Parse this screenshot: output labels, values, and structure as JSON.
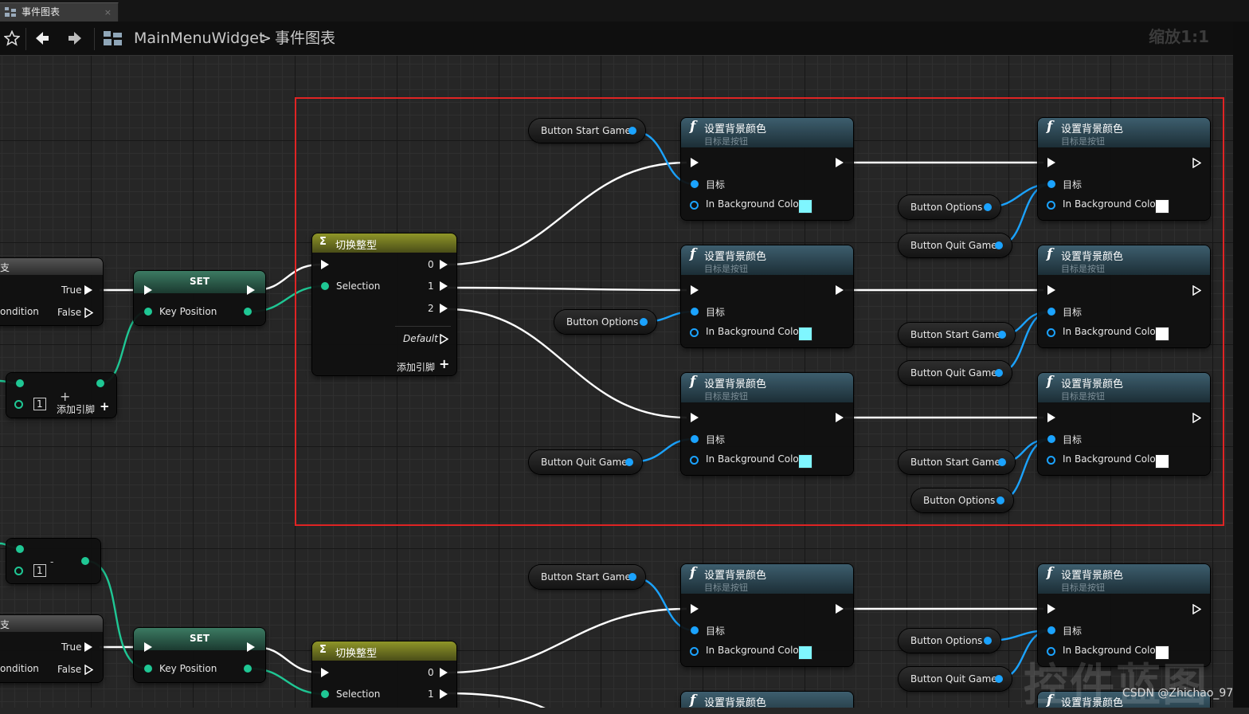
{
  "tab": {
    "label": "事件图表",
    "close": "×"
  },
  "breadcrumb": {
    "widget": "MainMenuWidget",
    "separator": ">",
    "page": "事件图表"
  },
  "zoom_label": "缩放1:1",
  "function_node": {
    "title": "设置背景颜色",
    "subtitle": "目标是按钮",
    "target_label": "目标",
    "color_label": "In Background Color"
  },
  "switch_node": {
    "title": "切换整型",
    "selection": "Selection",
    "pin0": "0",
    "pin1": "1",
    "pin2": "2",
    "default": "Default",
    "add_pin": "添加引脚"
  },
  "set_node": {
    "title": "SET",
    "key_position": "Key Position"
  },
  "branch_node": {
    "title": "支",
    "true_label": "True",
    "condition_label": "ondition",
    "false_label": "False"
  },
  "make_array": {
    "index": "1",
    "add_pin": "添加引脚"
  },
  "variables": {
    "start": "Button Start Game",
    "options": "Button Options",
    "quit": "Button Quit Game"
  },
  "colors": {
    "highlight": "#7ff6ff",
    "white": "#ffffff",
    "selection_box": "#e02424"
  },
  "watermark": "控件蓝图",
  "credit": "CSDN @Zhichao_97"
}
